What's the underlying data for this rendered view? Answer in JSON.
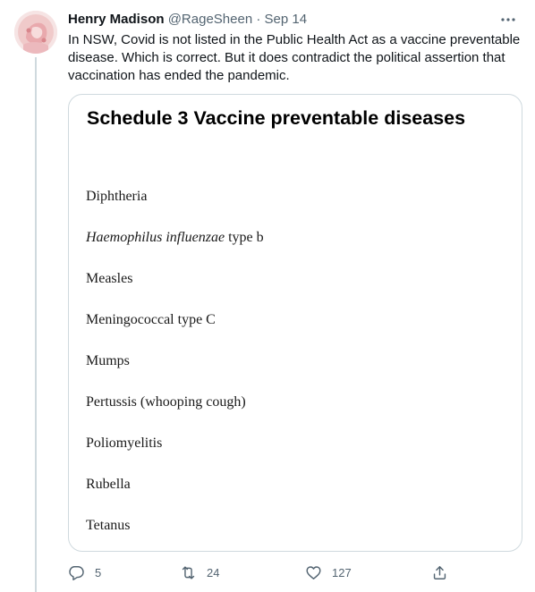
{
  "tweet": {
    "author_name": "Henry Madison",
    "handle": "@RageSheen",
    "separator": "·",
    "date": "Sep 14",
    "text": "In NSW, Covid is not listed in the Public Health Act as a vaccine preventable disease. Which is correct. But it does contradict the political assertion that vaccination has ended the pandemic."
  },
  "media": {
    "title": "Schedule 3 Vaccine preventable diseases",
    "diseases": [
      "Diphtheria",
      "Haemophilus influenzae type b",
      "Measles",
      "Meningococcal type C",
      "Mumps",
      "Pertussis (whooping cough)",
      "Poliomyelitis",
      "Rubella",
      "Tetanus"
    ],
    "italic_part": "Haemophilus influenzae",
    "italic_suffix": " type b"
  },
  "actions": {
    "reply_count": "5",
    "retweet_count": "24",
    "like_count": "127"
  },
  "icons": {
    "avatar": "avatar-portrait",
    "more": "more-icon",
    "reply": "reply-icon",
    "retweet": "retweet-icon",
    "like": "like-icon",
    "share": "share-icon"
  },
  "colors": {
    "secondary_text": "#536471",
    "border": "#cfd9de",
    "avatar_background": "#f4dede"
  }
}
